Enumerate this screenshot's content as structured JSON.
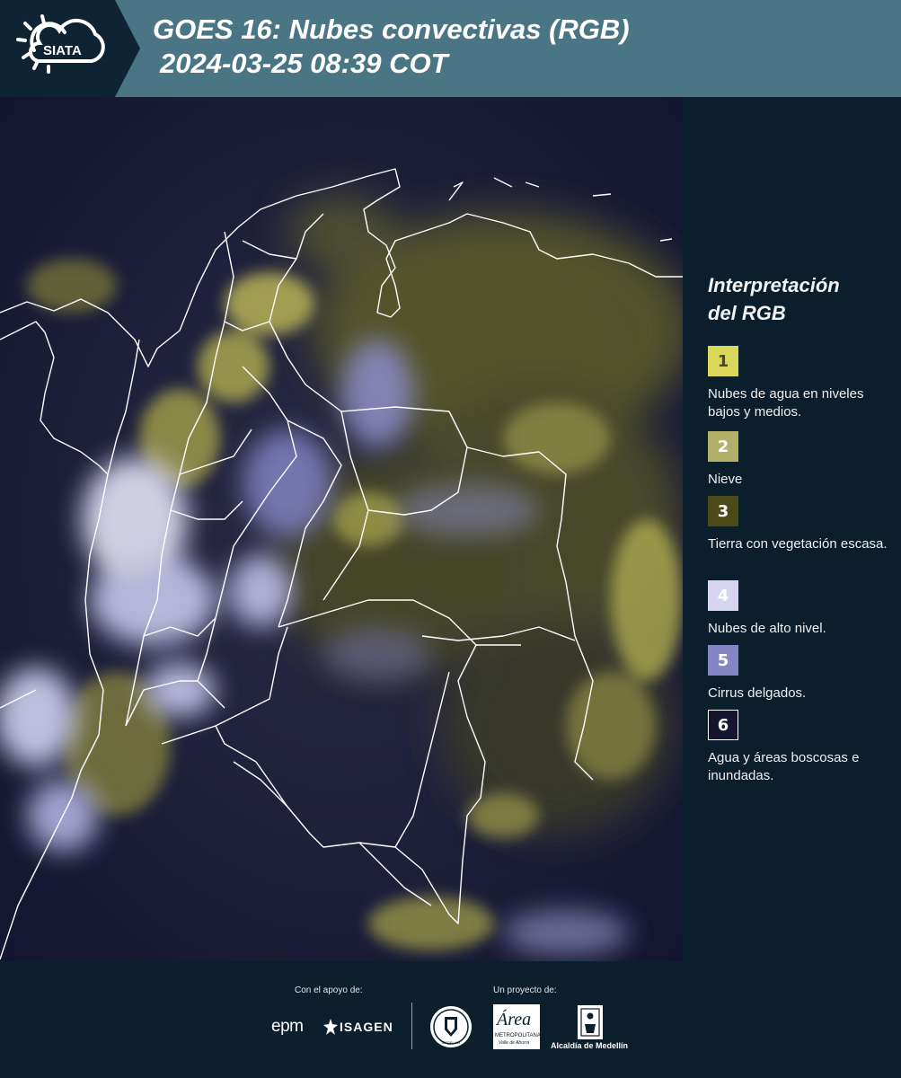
{
  "header": {
    "logo_text": "SIATA",
    "title_line1": "GOES 16: Nubes convectivas (RGB)",
    "title_line2": "2024-03-25 08:39 COT"
  },
  "legend": {
    "title_line1": "Interpretación",
    "title_line2": "del RGB",
    "items": [
      {
        "num": "1",
        "label": "Nubes de agua en niveles bajos y medios.",
        "color": "#d9d85a",
        "text_color": "#4a4a20"
      },
      {
        "num": "2",
        "label": "Nieve",
        "color": "#b3b069",
        "text_color": "#ffffff"
      },
      {
        "num": "3",
        "label": "Tierra con vegetación escasa.",
        "color": "#4d4a1a",
        "text_color": "#ffffff"
      },
      {
        "num": "4",
        "label": "Nubes de alto nivel.",
        "color": "#d6d6f2",
        "text_color": "#ffffff"
      },
      {
        "num": "5",
        "label": "Cirrus delgados.",
        "color": "#8585c4",
        "text_color": "#ffffff"
      },
      {
        "num": "6",
        "label": "Agua y áreas boscosas e inundadas.",
        "color": "#151530",
        "text_color": "#ffffff"
      }
    ]
  },
  "footer": {
    "support_label": "Con el apoyo de:",
    "project_label": "Un proyecto de:",
    "sponsor1": "epm",
    "sponsor2": "ISAGEN",
    "partner_area_title": "Área",
    "partner_area_sub1": "METROPOLITANA",
    "partner_area_sub2": "Valle de Aburrá",
    "partner_alcaldia": "Alcaldía de Medellín",
    "partner_seal_text": "MEDELLÍN"
  }
}
